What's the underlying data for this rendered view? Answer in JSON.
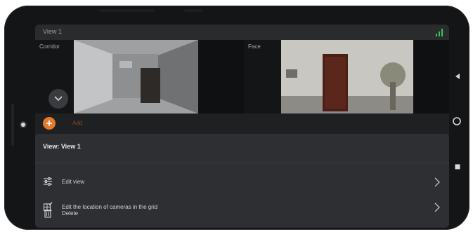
{
  "header": {
    "view_title": "View 1"
  },
  "cameras": [
    {
      "label": "Corridor"
    },
    {
      "label": "Face"
    }
  ],
  "add": {
    "label": "Add"
  },
  "sheet": {
    "title": "View: View 1",
    "items": [
      {
        "label": "Edit view",
        "icon": "sliders-icon",
        "has_chevron": true
      },
      {
        "label": "Edit the location of cameras in the grid",
        "icon": "grid-edit-icon",
        "has_chevron": true
      },
      {
        "label": "Delete",
        "icon": "trash-icon",
        "has_chevron": false
      }
    ]
  },
  "colors": {
    "accent": "#e37a2c",
    "signal": "#34c759"
  },
  "icons": {
    "signal": "signal-icon",
    "expand": "chevron-down-icon",
    "nav_back": "back-triangle-icon",
    "nav_home": "home-circle-icon",
    "nav_recents": "recents-square-icon"
  }
}
